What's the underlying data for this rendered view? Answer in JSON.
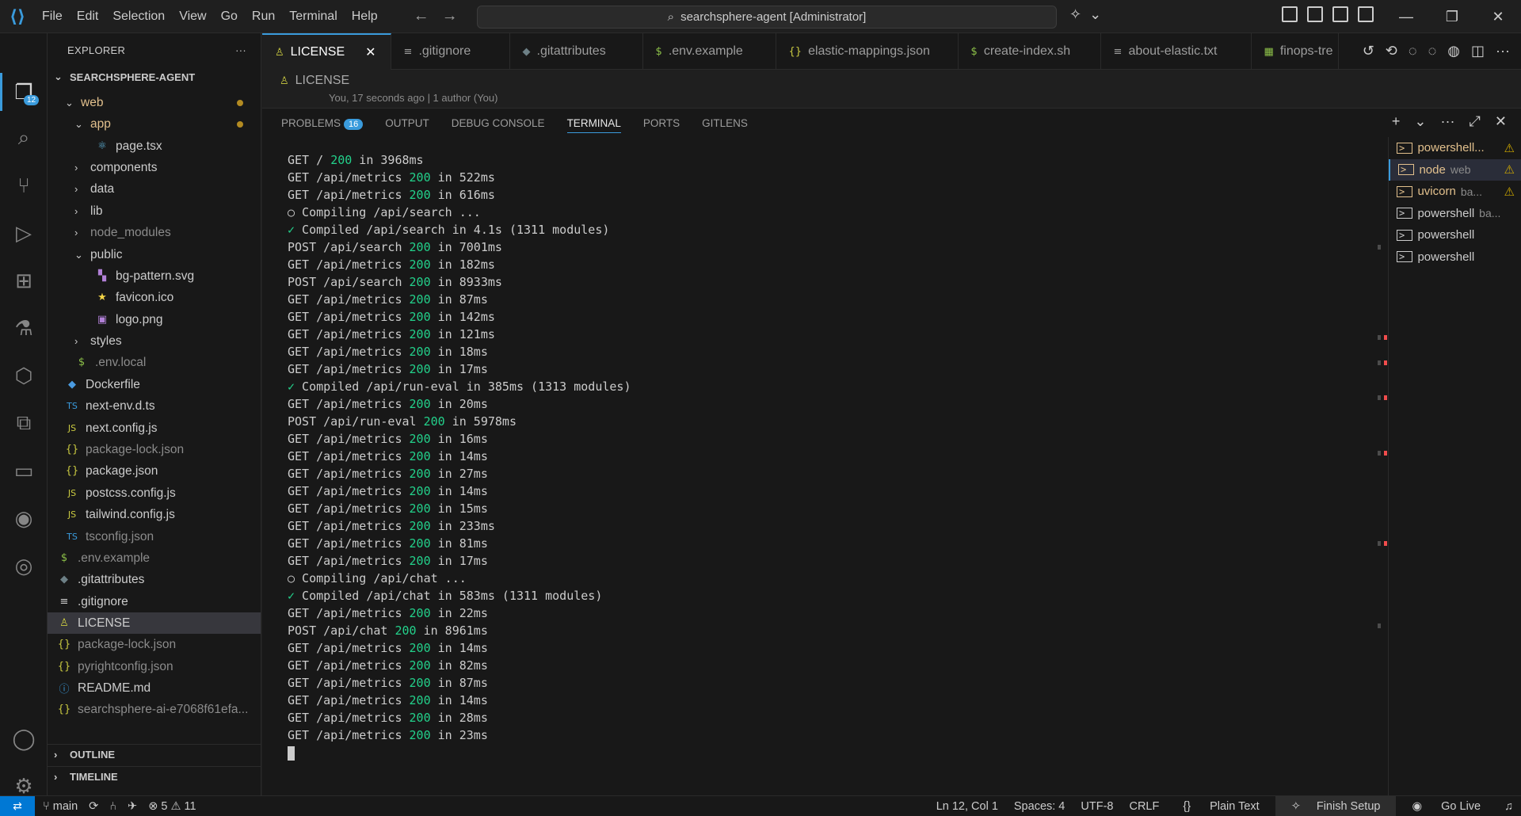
{
  "menu": [
    "File",
    "Edit",
    "Selection",
    "View",
    "Go",
    "Run",
    "Terminal",
    "Help"
  ],
  "command_center": "searchsphere-agent [Administrator]",
  "activity": {
    "explorer_badge": "12"
  },
  "sidebar": {
    "title": "EXPLORER",
    "root": "SEARCHSPHERE-AGENT",
    "items": [
      {
        "label": "web",
        "type": "folder-open"
      },
      {
        "label": "app",
        "type": "folder-open"
      },
      {
        "label": "page.tsx",
        "type": "file"
      },
      {
        "label": "components",
        "type": "folder"
      },
      {
        "label": "data",
        "type": "folder"
      },
      {
        "label": "lib",
        "type": "folder"
      },
      {
        "label": "node_modules",
        "type": "folder"
      },
      {
        "label": "public",
        "type": "folder-open"
      },
      {
        "label": "bg-pattern.svg",
        "type": "file"
      },
      {
        "label": "favicon.ico",
        "type": "file"
      },
      {
        "label": "logo.png",
        "type": "file"
      },
      {
        "label": "styles",
        "type": "folder"
      },
      {
        "label": ".env.local",
        "type": "file"
      },
      {
        "label": "Dockerfile",
        "type": "file"
      },
      {
        "label": "next-env.d.ts",
        "type": "file"
      },
      {
        "label": "next.config.js",
        "type": "file"
      },
      {
        "label": "package-lock.json",
        "type": "file"
      },
      {
        "label": "package.json",
        "type": "file"
      },
      {
        "label": "postcss.config.js",
        "type": "file"
      },
      {
        "label": "tailwind.config.js",
        "type": "file"
      },
      {
        "label": "tsconfig.json",
        "type": "file"
      },
      {
        "label": ".env.example",
        "type": "file"
      },
      {
        "label": ".gitattributes",
        "type": "file"
      },
      {
        "label": ".gitignore",
        "type": "file"
      },
      {
        "label": "LICENSE",
        "type": "file"
      },
      {
        "label": "package-lock.json",
        "type": "file"
      },
      {
        "label": "pyrightconfig.json",
        "type": "file"
      },
      {
        "label": "README.md",
        "type": "file"
      },
      {
        "label": "searchsphere-ai-e7068f61efa...",
        "type": "file"
      }
    ],
    "outline": "OUTLINE",
    "timeline": "TIMELINE"
  },
  "tabs": [
    {
      "label": "LICENSE",
      "icon": "license-icon"
    },
    {
      "label": ".gitignore",
      "icon": "lines-icon"
    },
    {
      "label": ".gitattributes",
      "icon": "diamond-icon"
    },
    {
      "label": ".env.example",
      "icon": "dollar-icon"
    },
    {
      "label": "elastic-mappings.json",
      "icon": "braces-icon"
    },
    {
      "label": "create-index.sh",
      "icon": "dollar-icon"
    },
    {
      "label": "about-elastic.txt",
      "icon": "lines-icon"
    },
    {
      "label": "finops-tre",
      "icon": "table-icon"
    }
  ],
  "breadcrumb": {
    "file": "LICENSE",
    "blame": "You, 17 seconds ago | 1 author (You)"
  },
  "panel": {
    "tabs": [
      "PROBLEMS",
      "OUTPUT",
      "DEBUG CONSOLE",
      "TERMINAL",
      "PORTS",
      "GITLENS"
    ],
    "problems_count": "16",
    "terminal_lines": [
      {
        "pre": "GET / ",
        "status": "200",
        "post": " in 3968ms"
      },
      {
        "pre": "GET /api/metrics ",
        "status": "200",
        "post": " in 522ms"
      },
      {
        "pre": "GET /api/metrics ",
        "status": "200",
        "post": " in 616ms"
      },
      {
        "pre": "○ Compiling /api/search ...",
        "status": "",
        "post": ""
      },
      {
        "check": "✓",
        "pre": " Compiled /api/search in 4.1s (1311 modules)",
        "status": "",
        "post": ""
      },
      {
        "pre": "POST /api/search ",
        "status": "200",
        "post": " in 7001ms"
      },
      {
        "pre": "GET /api/metrics ",
        "status": "200",
        "post": " in 182ms"
      },
      {
        "pre": "POST /api/search ",
        "status": "200",
        "post": " in 8933ms"
      },
      {
        "pre": "GET /api/metrics ",
        "status": "200",
        "post": " in 87ms"
      },
      {
        "pre": "GET /api/metrics ",
        "status": "200",
        "post": " in 142ms"
      },
      {
        "pre": "GET /api/metrics ",
        "status": "200",
        "post": " in 121ms"
      },
      {
        "pre": "GET /api/metrics ",
        "status": "200",
        "post": " in 18ms"
      },
      {
        "pre": "GET /api/metrics ",
        "status": "200",
        "post": " in 17ms"
      },
      {
        "check": "✓",
        "pre": " Compiled /api/run-eval in 385ms (1313 modules)",
        "status": "",
        "post": ""
      },
      {
        "pre": "GET /api/metrics ",
        "status": "200",
        "post": " in 20ms"
      },
      {
        "pre": "POST /api/run-eval ",
        "status": "200",
        "post": " in 5978ms"
      },
      {
        "pre": "GET /api/metrics ",
        "status": "200",
        "post": " in 16ms"
      },
      {
        "pre": "GET /api/metrics ",
        "status": "200",
        "post": " in 14ms"
      },
      {
        "pre": "GET /api/metrics ",
        "status": "200",
        "post": " in 27ms"
      },
      {
        "pre": "GET /api/metrics ",
        "status": "200",
        "post": " in 14ms"
      },
      {
        "pre": "GET /api/metrics ",
        "status": "200",
        "post": " in 15ms"
      },
      {
        "pre": "GET /api/metrics ",
        "status": "200",
        "post": " in 233ms"
      },
      {
        "pre": "GET /api/metrics ",
        "status": "200",
        "post": " in 81ms"
      },
      {
        "pre": "GET /api/metrics ",
        "status": "200",
        "post": " in 17ms"
      },
      {
        "pre": "○ Compiling /api/chat ...",
        "status": "",
        "post": ""
      },
      {
        "check": "✓",
        "pre": " Compiled /api/chat in 583ms (1311 modules)",
        "status": "",
        "post": ""
      },
      {
        "pre": "GET /api/metrics ",
        "status": "200",
        "post": " in 22ms"
      },
      {
        "pre": "POST /api/chat ",
        "status": "200",
        "post": " in 8961ms"
      },
      {
        "pre": "GET /api/metrics ",
        "status": "200",
        "post": " in 14ms"
      },
      {
        "pre": "GET /api/metrics ",
        "status": "200",
        "post": " in 82ms"
      },
      {
        "pre": "GET /api/metrics ",
        "status": "200",
        "post": " in 87ms"
      },
      {
        "pre": "GET /api/metrics ",
        "status": "200",
        "post": " in 14ms"
      },
      {
        "pre": "GET /api/metrics ",
        "status": "200",
        "post": " in 28ms"
      },
      {
        "pre": "GET /api/metrics ",
        "status": "200",
        "post": " in 23ms"
      }
    ],
    "terminals": [
      {
        "name": "powershell...",
        "detail": "",
        "warn": true,
        "color": "yellow"
      },
      {
        "name": "node",
        "detail": "web",
        "warn": true,
        "color": "yellow",
        "selected": true
      },
      {
        "name": "uvicorn",
        "detail": "ba...",
        "warn": true,
        "color": "yellow"
      },
      {
        "name": "powershell",
        "detail": "ba...",
        "warn": false,
        "color": ""
      },
      {
        "name": "powershell",
        "detail": "",
        "warn": false,
        "color": ""
      },
      {
        "name": "powershell",
        "detail": "",
        "warn": false,
        "color": ""
      }
    ]
  },
  "status": {
    "branch": "main",
    "errors": "5",
    "warnings": "11",
    "position": "Ln 12, Col 1",
    "spaces": "Spaces: 4",
    "encoding": "UTF-8",
    "eol": "CRLF",
    "language": "Plain Text",
    "finish_setup": "Finish Setup",
    "go_live": "Go Live"
  },
  "colors": {
    "accent": "#3a9bdc",
    "ok": "#23d18b",
    "warn": "#cca700",
    "error": "#f14c4c"
  }
}
